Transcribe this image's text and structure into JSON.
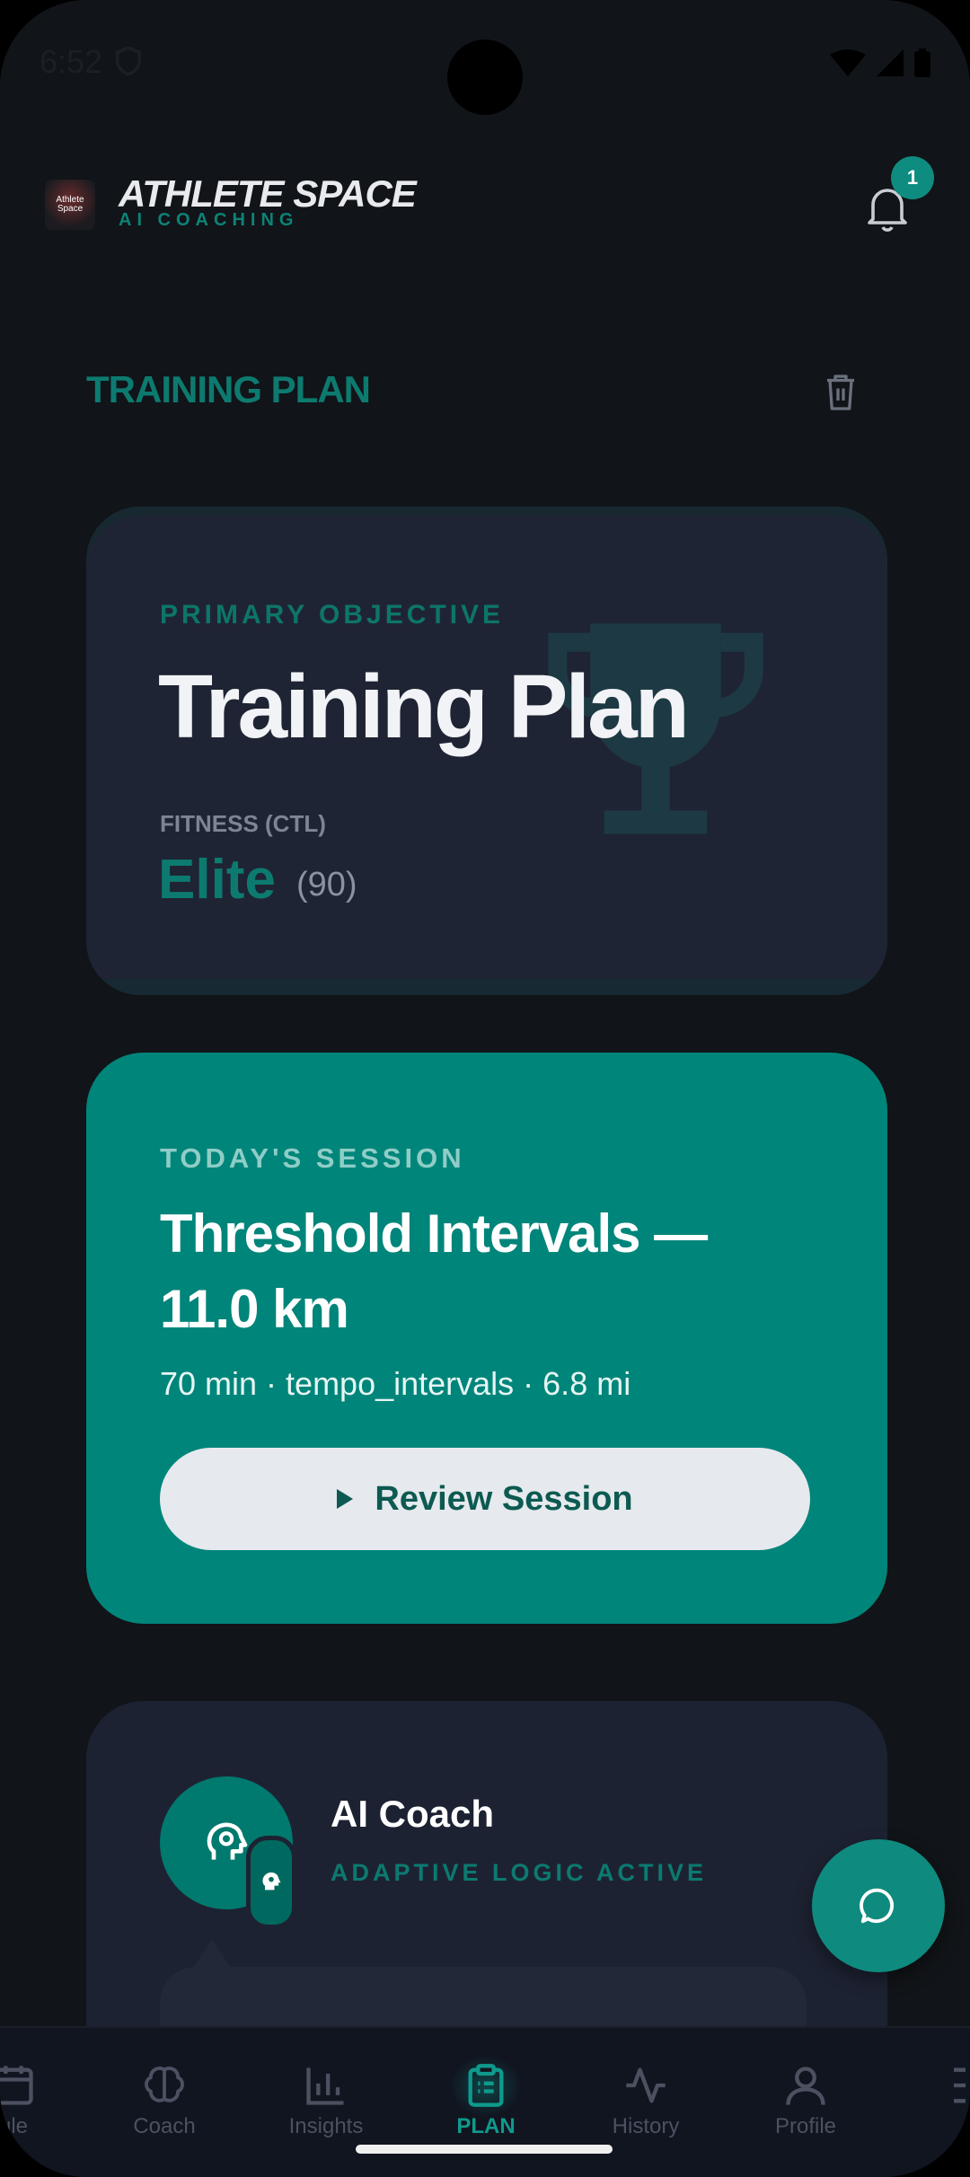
{
  "status_bar": {
    "time": "6:52"
  },
  "header": {
    "logo_text": "Athlete Space",
    "brand": "ATHLETE SPACE",
    "brand_sub": "AI COACHING",
    "notification_count": "1"
  },
  "section": {
    "title": "TRAINING PLAN"
  },
  "objective_card": {
    "label": "PRIMARY OBJECTIVE",
    "title": "Training Plan",
    "fitness_label": "FITNESS (CTL)",
    "fitness_value": "Elite",
    "fitness_number": "(90)"
  },
  "session_card": {
    "label": "TODAY'S SESSION",
    "title": "Threshold Intervals — 11.0 km",
    "meta": "70 min · tempo_intervals · 6.8 mi",
    "button": "Review Session"
  },
  "coach_card": {
    "name": "AI Coach",
    "status": "ADAPTIVE LOGIC ACTIVE"
  },
  "nav": {
    "items": [
      {
        "label": "ule",
        "icon": "schedule-icon"
      },
      {
        "label": "Coach",
        "icon": "brain-icon"
      },
      {
        "label": "Insights",
        "icon": "bar-chart-icon"
      },
      {
        "label": "PLAN",
        "icon": "clipboard-icon",
        "active": true
      },
      {
        "label": "History",
        "icon": "activity-icon"
      },
      {
        "label": "Profile",
        "icon": "user-icon"
      }
    ]
  },
  "colors": {
    "background": "#111418",
    "accent": "#00857a",
    "card": "#1f2434",
    "teal_text": "#0d7a70"
  }
}
